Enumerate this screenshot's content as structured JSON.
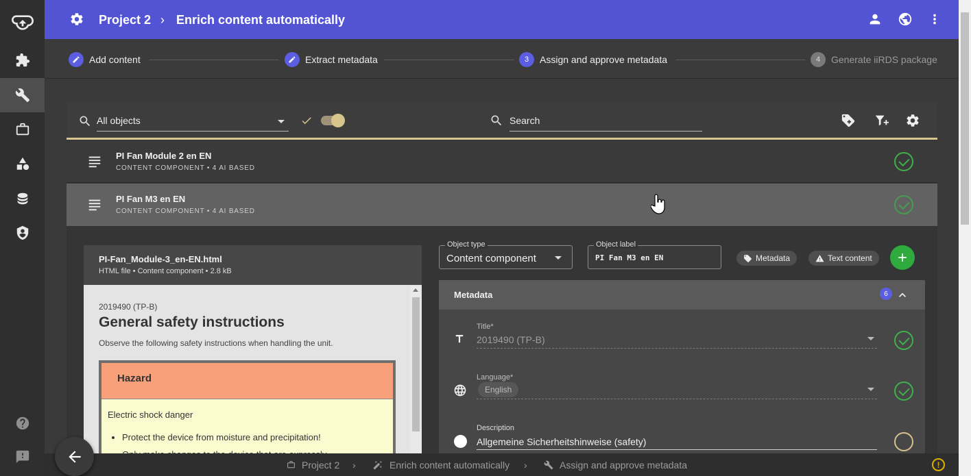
{
  "header": {
    "breadcrumb_project": "Project 2",
    "breadcrumb_sep": "›",
    "page_title": "Enrich content automatically"
  },
  "stepper": {
    "steps": [
      {
        "label": "Add content",
        "state": "done"
      },
      {
        "label": "Extract metadata",
        "state": "done"
      },
      {
        "label": "Assign and approve metadata",
        "number": "3",
        "state": "active"
      },
      {
        "label": "Generate iiRDS package",
        "number": "4",
        "state": "disabled"
      }
    ]
  },
  "toolbar": {
    "filter_selected": "All objects",
    "search_placeholder": "Search"
  },
  "objects": [
    {
      "title": "PI Fan Module 2 en EN",
      "subtitle": "CONTENT COMPONENT • 4 AI BASED",
      "status": "approved"
    },
    {
      "title": "PI Fan M3 en EN",
      "subtitle": "CONTENT COMPONENT • 4 AI BASED",
      "status": "approved"
    }
  ],
  "preview": {
    "filename": "PI-Fan_Module-3_en-EN.html",
    "fileinfo": "HTML file • Content component • 2.8 kB",
    "doc_code": "2019490 (TP-B)",
    "doc_heading": "General safety instructions",
    "doc_intro": "Observe the following safety instructions when handling the unit.",
    "hazard_title": "Hazard",
    "hazard_subtitle": "Electric shock danger",
    "hazard_items": [
      "Protect the device from moisture and precipitation!",
      "Only make changes to the device that are expressly"
    ]
  },
  "form": {
    "object_type_label": "Object type",
    "object_type_value": "Content component",
    "object_label_label": "Object label",
    "object_label_value": "PI Fan M3 en EN",
    "chip_metadata": "Metadata",
    "chip_text_content": "Text content",
    "metadata_section": "Metadata",
    "metadata_count": "6",
    "fields": [
      {
        "label": "Title*",
        "value": "2019490 (TP-B)",
        "status": "approved"
      },
      {
        "label": "Language*",
        "value": "English",
        "status": "approved"
      },
      {
        "label": "Description",
        "value": "Allgemeine Sicherheitshinweise (safety)",
        "status": "pending"
      }
    ]
  },
  "bottom": {
    "crumb1": "Project 2",
    "crumb2": "Enrich content automatically",
    "crumb3": "Assign and approve metadata"
  },
  "colors": {
    "topbar": "#5254d4",
    "approved": "#3fb04c",
    "pending": "#d7c08c",
    "add_button": "#2eaa3f",
    "hazard": "#f8a07a",
    "hazard_body": "#fbfbd0"
  }
}
